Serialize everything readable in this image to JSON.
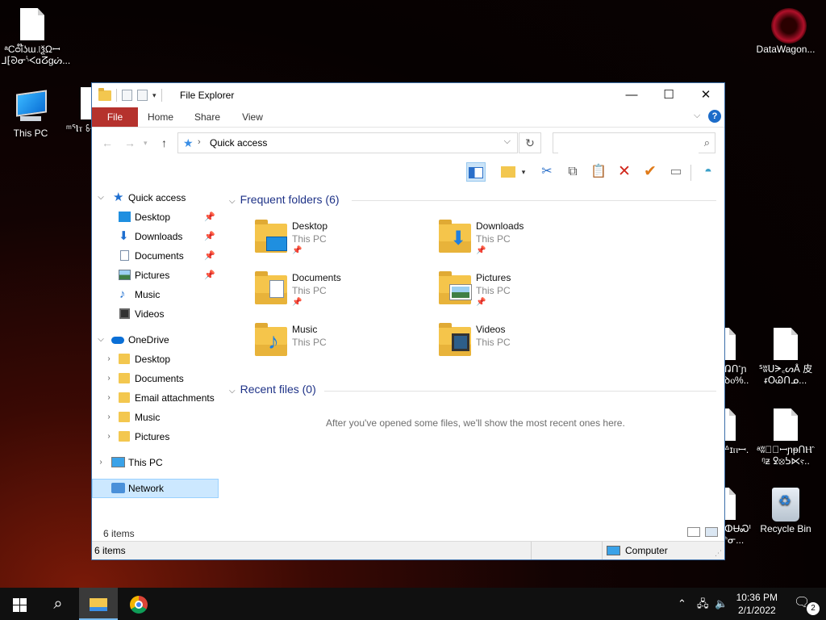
{
  "desktop": {
    "icons": [
      {
        "label": "ᵃCᴑi໊ʖɯ꜌ѯΩꟷ ⅃⁅ᘐᓂᔌɑⵒɡᔖ...",
        "kind": "file"
      },
      {
        "label": "This PC",
        "kind": "computer"
      },
      {
        "label": "ᵐᕐⲒⲧ ꗏ⟺m",
        "kind": "file"
      },
      {
        "label": "DataWagon...",
        "kind": "shortcut"
      },
      {
        "label": "ᕡՈ⳿ɲ ꝺⲟ%..",
        "kind": "file"
      },
      {
        "label": "ᔆʬᑌᗒ꜀ᔕÅ 皮ᵲՕᏊᑎᓄ...",
        "kind": "file"
      },
      {
        "label": "ᐞɪⲡꟷ.",
        "kind": "file"
      },
      {
        "label": "ᵃʬᑲ⃥ꟷɲᵽՈⲎ⳿ᵑᵶ ꝿ⦻ᕊ⋉ⲋ..",
        "kind": "file"
      },
      {
        "label": "ⵀɄᏍᑊ ᑋᓂ...",
        "kind": "file"
      },
      {
        "label": "Recycle Bin",
        "kind": "recycle-bin"
      }
    ]
  },
  "window": {
    "title": "File Explorer",
    "controls": {
      "minimize": "—",
      "maximize": "☐",
      "close": "✕"
    },
    "ribbon_tabs": [
      "File",
      "Home",
      "Share",
      "View"
    ],
    "address": {
      "path": "Quick access",
      "separator": "›"
    },
    "search": {
      "placeholder": "",
      "value": ""
    },
    "toolbar": [
      "preview-pane",
      "new-folder",
      "cut",
      "copy",
      "paste",
      "delete",
      "rename",
      "properties",
      "open"
    ],
    "nav": {
      "quick_access": {
        "label": "Quick access",
        "items": [
          {
            "label": "Desktop",
            "pinned": true
          },
          {
            "label": "Downloads",
            "pinned": true
          },
          {
            "label": "Documents",
            "pinned": true
          },
          {
            "label": "Pictures",
            "pinned": true
          },
          {
            "label": "Music",
            "pinned": false
          },
          {
            "label": "Videos",
            "pinned": false
          }
        ]
      },
      "onedrive": {
        "label": "OneDrive",
        "items": [
          "Desktop",
          "Documents",
          "Email attachments",
          "Music",
          "Pictures"
        ]
      },
      "this_pc": "This PC",
      "network": "Network"
    },
    "frequent": {
      "header": "Frequent folders (6)",
      "items": [
        {
          "name": "Desktop",
          "location": "This PC",
          "pinned": true
        },
        {
          "name": "Downloads",
          "location": "This PC",
          "pinned": true
        },
        {
          "name": "Documents",
          "location": "This PC",
          "pinned": true
        },
        {
          "name": "Pictures",
          "location": "This PC",
          "pinned": true
        },
        {
          "name": "Music",
          "location": "This PC",
          "pinned": false
        },
        {
          "name": "Videos",
          "location": "This PC",
          "pinned": false
        }
      ]
    },
    "recent": {
      "header": "Recent files (0)",
      "empty_message": "After you've opened some files, we'll show the most recent ones here."
    },
    "status": {
      "count": "6 items",
      "bar_count": "6 items",
      "zone": "Computer"
    }
  },
  "taskbar": {
    "time": "10:36 PM",
    "date": "2/1/2022",
    "notifications": "2"
  }
}
